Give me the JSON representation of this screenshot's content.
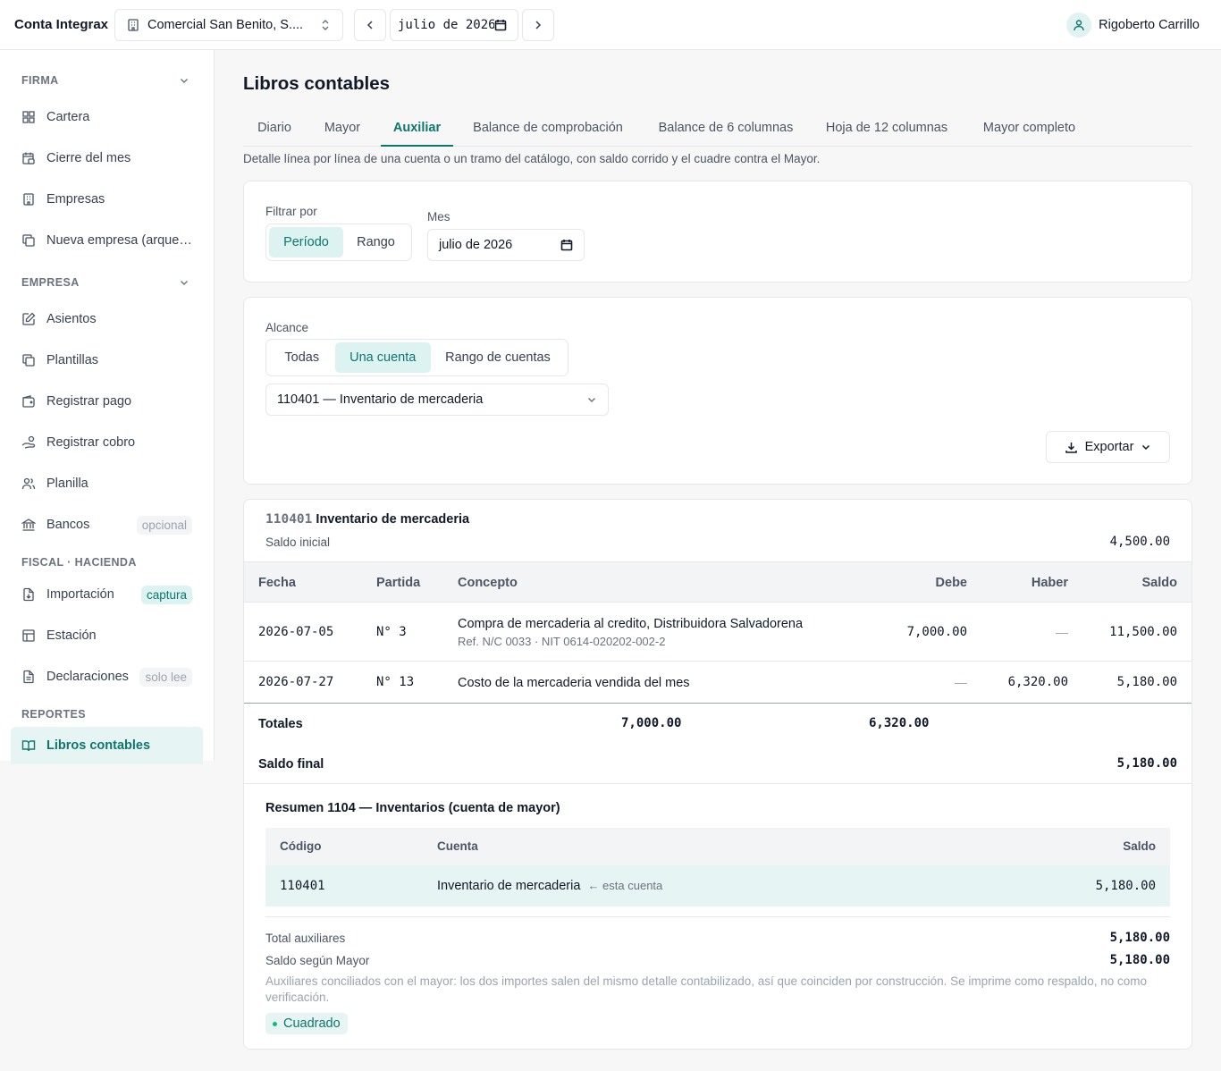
{
  "header": {
    "brand": "Conta Integrax",
    "company": "Comercial San Benito, S....",
    "date_value": "julio de 2026",
    "user_name": "Rigoberto Carrillo"
  },
  "sidebar": {
    "sections": [
      {
        "label": "FIRMA"
      },
      {
        "label": "EMPRESA"
      },
      {
        "label": "FISCAL · HACIENDA"
      },
      {
        "label": "REPORTES"
      }
    ],
    "items": [
      {
        "label": "Cartera",
        "icon": "grid-icon"
      },
      {
        "label": "Cierre del mes",
        "icon": "calendar-lock-icon"
      },
      {
        "label": "Empresas",
        "icon": "building-icon"
      },
      {
        "label": "Nueva empresa (arqueo de onboarding)",
        "icon": "copy-icon"
      },
      {
        "label": "Asientos",
        "icon": "edit-icon"
      },
      {
        "label": "Plantillas",
        "icon": "copy-icon"
      },
      {
        "label": "Registrar pago",
        "icon": "wallet-icon"
      },
      {
        "label": "Registrar cobro",
        "icon": "hand-coins-icon"
      },
      {
        "label": "Planilla",
        "icon": "users-icon"
      },
      {
        "label": "Bancos",
        "icon": "bank-icon",
        "badge": "opcional"
      },
      {
        "label": "Importación",
        "icon": "file-import-icon",
        "badge": "captura"
      },
      {
        "label": "Estación",
        "icon": "table-icon"
      },
      {
        "label": "Declaraciones",
        "icon": "file-text-icon",
        "badge": "solo lee"
      },
      {
        "label": "Libros contables",
        "icon": "book-open-icon"
      }
    ]
  },
  "main": {
    "title": "Libros contables",
    "tabs": [
      {
        "label": "Diario"
      },
      {
        "label": "Mayor"
      },
      {
        "label": "Auxiliar"
      },
      {
        "label": "Balance de comprobación"
      },
      {
        "label": "Balance de 6 columnas"
      },
      {
        "label": "Hoja de 12 columnas"
      },
      {
        "label": "Mayor completo"
      }
    ],
    "description": "Detalle línea por línea de una cuenta o un tramo del catálogo, con saldo corrido y el cuadre contra el Mayor."
  },
  "filter": {
    "filter_label": "Filtrar por",
    "options": [
      "Período",
      "Rango"
    ],
    "month_label": "Mes",
    "month_value": "julio de 2026"
  },
  "scope": {
    "label": "Alcance",
    "options": [
      "Todas",
      "Una cuenta",
      "Rango de cuentas"
    ],
    "account_value": "110401 — Inventario de mercaderia",
    "export_label": "Exportar"
  },
  "ledger": {
    "account_code": "110401",
    "account_name": "Inventario de mercaderia",
    "opening_label": "Saldo inicial",
    "opening_value": "4,500.00",
    "columns": {
      "fecha": "Fecha",
      "partida": "Partida",
      "concepto": "Concepto",
      "debe": "Debe",
      "haber": "Haber",
      "saldo": "Saldo"
    },
    "rows": [
      {
        "fecha": "2026-07-05",
        "partida": "N° 3",
        "concepto": "Compra de mercaderia al credito, Distribuidora Salvadorena",
        "ref": "Ref. N/C 0033 · NIT 0614-020202-002-2",
        "debe": "7,000.00",
        "haber": "—",
        "saldo": "11,500.00"
      },
      {
        "fecha": "2026-07-27",
        "partida": "N° 13",
        "concepto": "Costo de la mercaderia vendida del mes",
        "ref": "",
        "debe": "—",
        "haber": "6,320.00",
        "saldo": "5,180.00"
      }
    ],
    "totals_label": "Totales",
    "totals_debe": "7,000.00",
    "totals_haber": "6,320.00",
    "final_label": "Saldo final",
    "final_value": "5,180.00"
  },
  "summary": {
    "title": "Resumen 1104 — Inventarios (cuenta de mayor)",
    "columns": {
      "codigo": "Código",
      "cuenta": "Cuenta",
      "saldo": "Saldo"
    },
    "row": {
      "codigo": "110401",
      "cuenta": "Inventario de mercaderia",
      "note": "← esta cuenta",
      "saldo": "5,180.00"
    },
    "total_aux_label": "Total auxiliares",
    "total_aux_value": "5,180.00",
    "saldo_mayor_label": "Saldo según Mayor",
    "saldo_mayor_value": "5,180.00",
    "note": "Auxiliares conciliados con el mayor: los dos importes salen del mismo detalle contabilizado, así que coinciden por construcción. Se imprime como respaldo, no como verificación.",
    "status": "Cuadrado"
  },
  "colors": {
    "accent": "#0f766e",
    "accent_bg": "#e6f4f3",
    "ok": "#10b981"
  }
}
